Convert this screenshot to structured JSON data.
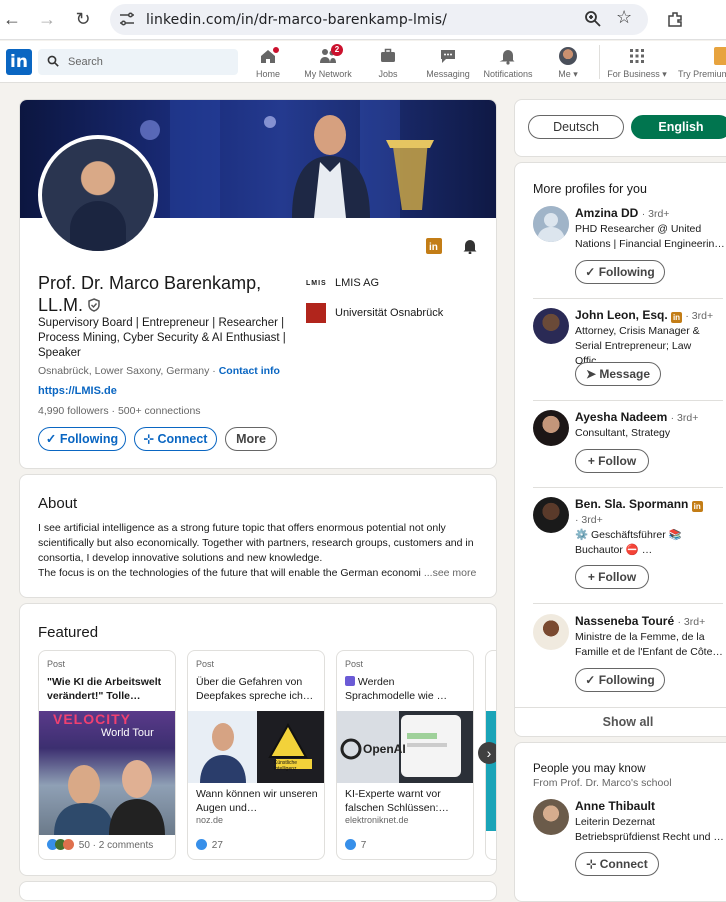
{
  "browser": {
    "url": "linkedin.com/in/dr-marco-barenkamp-lmis/"
  },
  "nav": {
    "search_placeholder": "Search",
    "items": [
      {
        "label": "Home",
        "icon": "home-icon"
      },
      {
        "label": "My Network",
        "icon": "network-icon",
        "badge": "2"
      },
      {
        "label": "Jobs",
        "icon": "briefcase-icon"
      },
      {
        "label": "Messaging",
        "icon": "message-icon"
      },
      {
        "label": "Notifications",
        "icon": "bell-icon"
      },
      {
        "label": "Me ▾",
        "icon": "me-avatar"
      },
      {
        "label": "For Business ▾",
        "icon": "grid-icon"
      },
      {
        "label": "Try Premium",
        "icon": "premium-icon"
      }
    ]
  },
  "profile": {
    "name": "Prof. Dr. Marco Barenkamp, LL.M.",
    "headline": "Supervisory Board | Entrepreneur | Researcher | Process Mining, Cyber Security & AI Enthusiast | Speaker",
    "location": "Osnabrück, Lower Saxony, Germany · ",
    "contact_info": "Contact info",
    "website": "https://LMIS.de",
    "followers": "4,990 followers · 500+ connections",
    "buttons": {
      "following": "Following",
      "connect": "Connect",
      "more": "More"
    },
    "orgs": [
      {
        "name": "LMIS AG",
        "logo_text": "LMIS"
      },
      {
        "name": "Universität Osnabrück"
      }
    ]
  },
  "about": {
    "title": "About",
    "text": "I see artificial intelligence as a strong future topic that offers enormous potential not only scientifically but also economically. Together with partners, research groups, customers and in consortia, I develop innovative solutions and new knowledge.\nThe focus is on the technologies of the future that will enable the German economi",
    "see_more": "...see more"
  },
  "featured": {
    "title": "Featured",
    "posts": [
      {
        "type": "Post",
        "title": "\"Wie KI die Arbeitswelt verändert!\" Tolle…",
        "image_text": "VELOCITY",
        "image_subtext": "World Tour",
        "caption": "",
        "source": "",
        "reactions": "50 · 2 comments"
      },
      {
        "type": "Post",
        "title": "Über die Gefahren von Deepfakes spreche ich…",
        "image_text": "Künstliche Intelligenz",
        "caption": "Wann können wir unseren Augen und…",
        "source": "noz.de",
        "reactions": "27"
      },
      {
        "type": "Post",
        "title": "Werden Sprachmodelle wie …",
        "image_text": "OpenAI",
        "caption": "KI-Experte warnt vor falschen Schlüssen:…",
        "source": "elektroniknet.de",
        "reactions": "7"
      }
    ]
  },
  "language": {
    "options": [
      "Deutsch",
      "English"
    ],
    "selected": "English"
  },
  "more_profiles": {
    "title": "More profiles for you",
    "people": [
      {
        "name": "Amzina DD",
        "degree": "· 3rd+",
        "desc": "PHD Researcher @ United Nations | Financial Engineerin…",
        "button": "Following",
        "btn_icon": "✓"
      },
      {
        "name": "John Leon, Esq.",
        "degree": "· 3rd+",
        "desc": "Attorney, Crisis Manager & Serial Entrepreneur; Law Offic…",
        "button": "Message",
        "btn_icon": "➤"
      },
      {
        "name": "Ayesha Nadeem",
        "degree": "· 3rd+",
        "desc": "Consultant, Strategy",
        "button": "Follow",
        "btn_icon": "+"
      },
      {
        "name": "Ben. Sla. Spormann",
        "degree": "· 3rd+",
        "desc": "⚙️ Geschäftsführer 📚 Buchautor ⛔ …",
        "button": "Follow",
        "btn_icon": "+"
      },
      {
        "name": "Nasseneba Touré",
        "degree": "· 3rd+",
        "desc": " Ministre de la Femme, de la Famille et de l'Enfant de Côte…",
        "button": "Following",
        "btn_icon": "✓"
      }
    ],
    "show_all": "Show all"
  },
  "people_you_may_know": {
    "title": "People you may know",
    "subtitle": "From Prof. Dr. Marco's school",
    "people": [
      {
        "name": "Anne Thibault",
        "desc": "Leiterin Dezernat Betriebsprüfdienst Recht und …",
        "button": "Connect"
      }
    ]
  }
}
